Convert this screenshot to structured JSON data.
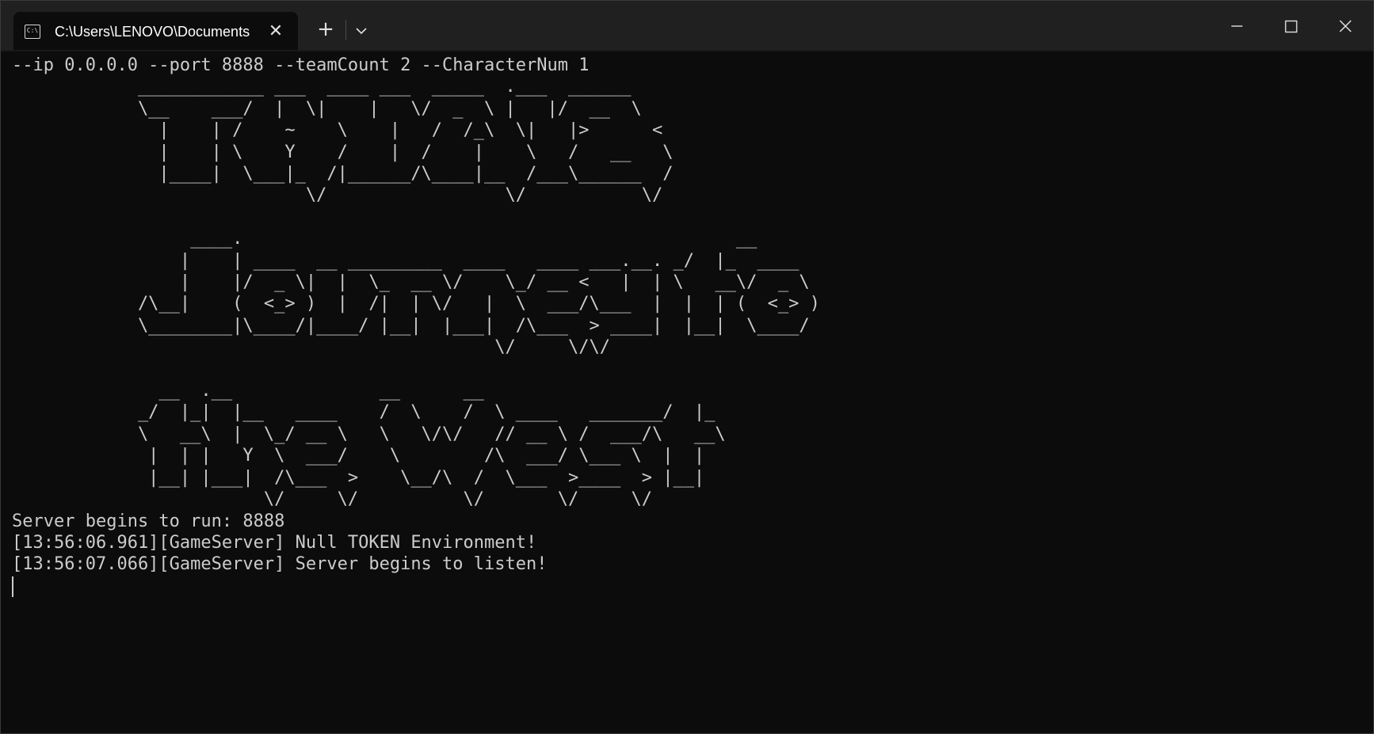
{
  "window": {
    "tab_title": "C:\\Users\\LENOVO\\Documents",
    "tab_icon_text": "C:\\"
  },
  "terminal": {
    "command_line": "--ip 0.0.0.0 --port 8888 --teamCount 2 --CharacterNum 1",
    "banner": [
      "            ____________ ___  ____ ___  _____  .___  ______",
      "            \\__    ___/  |  \\|    |   \\/  _  \\ |   |/  __  \\",
      "              |    | /    ~    \\    |   /  /_\\  \\|   |>      <",
      "              |    | \\    Y    /    |  /    |    \\   /   __   \\",
      "              |____|  \\___|_  /|______/\\____|__  /___\\______  /",
      "                            \\/                 \\/           \\/",
      "",
      "                 ____.                                               __",
      "                |    | ____  __ _________  ____   ____ ___.__. _/  |_  ____",
      "                |    |/  _ \\|  |  \\_  __ \\/    \\_/ __ <   |  | \\   __\\/  _ \\",
      "            /\\__|    (  <_> )  |  /|  | \\/   |  \\  ___/\\___  |  |  | (  <_> )",
      "            \\________|\\____/|____/ |__|  |___|  /\\___  > ____|  |__|  \\____/",
      "                                              \\/     \\/\\/",
      "",
      "              __  .__              __      __",
      "            _/  |_|  |__   ____    /  \\    /  \\ ____   _______/  |_",
      "            \\   __\\  |  \\_/ __ \\   \\   \\/\\/   // __ \\ /  ___/\\   __\\",
      "             |  | |   Y  \\  ___/    \\        /\\  ___/ \\___ \\  |  |",
      "             |__| |___|  /\\___  >    \\__/\\  /  \\___  >____  > |__|",
      "                        \\/     \\/          \\/       \\/     \\/"
    ],
    "log_lines": [
      "Server begins to run: 8888",
      "[13:56:06.961][GameServer] Null TOKEN Environment!",
      "[13:56:07.066][GameServer] Server begins to listen!"
    ]
  }
}
